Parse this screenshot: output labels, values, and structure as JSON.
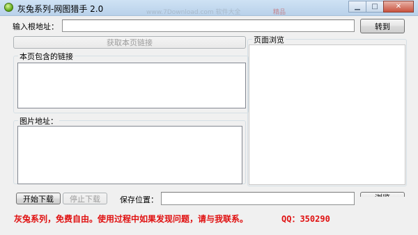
{
  "window": {
    "title": "灰兔系列-网图猎手 2.0",
    "background_caption": "www.7Download.com 软件大全",
    "background_caption_right": "精品"
  },
  "form": {
    "root_url_label": "输入根地址：",
    "root_url_value": "",
    "goto_button": "转到",
    "fetch_links_button": "获取本页链接",
    "links_group_title": "本页包含的链接",
    "images_group_title": "图片地址：",
    "preview_group_title": "页面浏览",
    "start_download_button": "开始下载",
    "stop_download_button": "停止下载",
    "save_location_label": "保存位置：",
    "save_location_value": "",
    "browse_button": "浏览"
  },
  "status": {
    "message": "灰兔系列，免费自由。使用过程中如果发现问题，请与我联系。",
    "qq": "QQ：350290"
  },
  "colors": {
    "status_text": "#e01010",
    "form_background": "#f0f0f0",
    "titlebar": "#c4d9ef"
  }
}
